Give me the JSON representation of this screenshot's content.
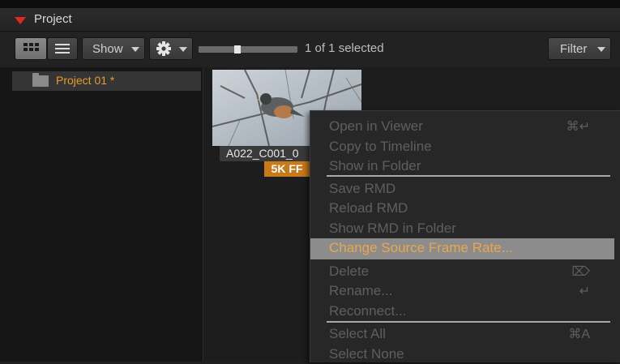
{
  "panel": {
    "title": "Project"
  },
  "toolbar": {
    "grid_view_icon": "grid-icon",
    "list_view_icon": "list-icon",
    "show_label": "Show",
    "gear_icon": "gear-icon",
    "selection_text": "1 of 1 selected",
    "filter_label": "Filter",
    "thumbnail_size_fraction": 0.39
  },
  "sidebar": {
    "items": [
      {
        "label": "Project 01 *",
        "icon": "folder-icon"
      }
    ]
  },
  "clips": [
    {
      "name": "A022_C001_0",
      "badge": "5K FF"
    }
  ],
  "context_menu": {
    "items": [
      {
        "label": "Open in Viewer",
        "shortcut": "⌘↵"
      },
      {
        "label": "Copy to Timeline",
        "shortcut": ""
      },
      {
        "label": "Show in Folder",
        "shortcut": ""
      },
      {
        "label": "Save RMD",
        "shortcut": ""
      },
      {
        "label": "Reload RMD",
        "shortcut": ""
      },
      {
        "label": "Show RMD in Folder",
        "shortcut": ""
      },
      {
        "label": "Change Source Frame Rate...",
        "shortcut": ""
      },
      {
        "label": "Delete",
        "shortcut": "⌦"
      },
      {
        "label": "Rename...",
        "shortcut": "↵"
      },
      {
        "label": "Reconnect...",
        "shortcut": ""
      },
      {
        "label": "Select All",
        "shortcut": "⌘A"
      },
      {
        "label": "Select None",
        "shortcut": ""
      }
    ],
    "highlighted_index": 6
  },
  "colors": {
    "accent_red": "#e02a1f",
    "project_label": "#e89a2a",
    "badge": "#c77a1a",
    "highlight_text": "#e9a84a"
  }
}
